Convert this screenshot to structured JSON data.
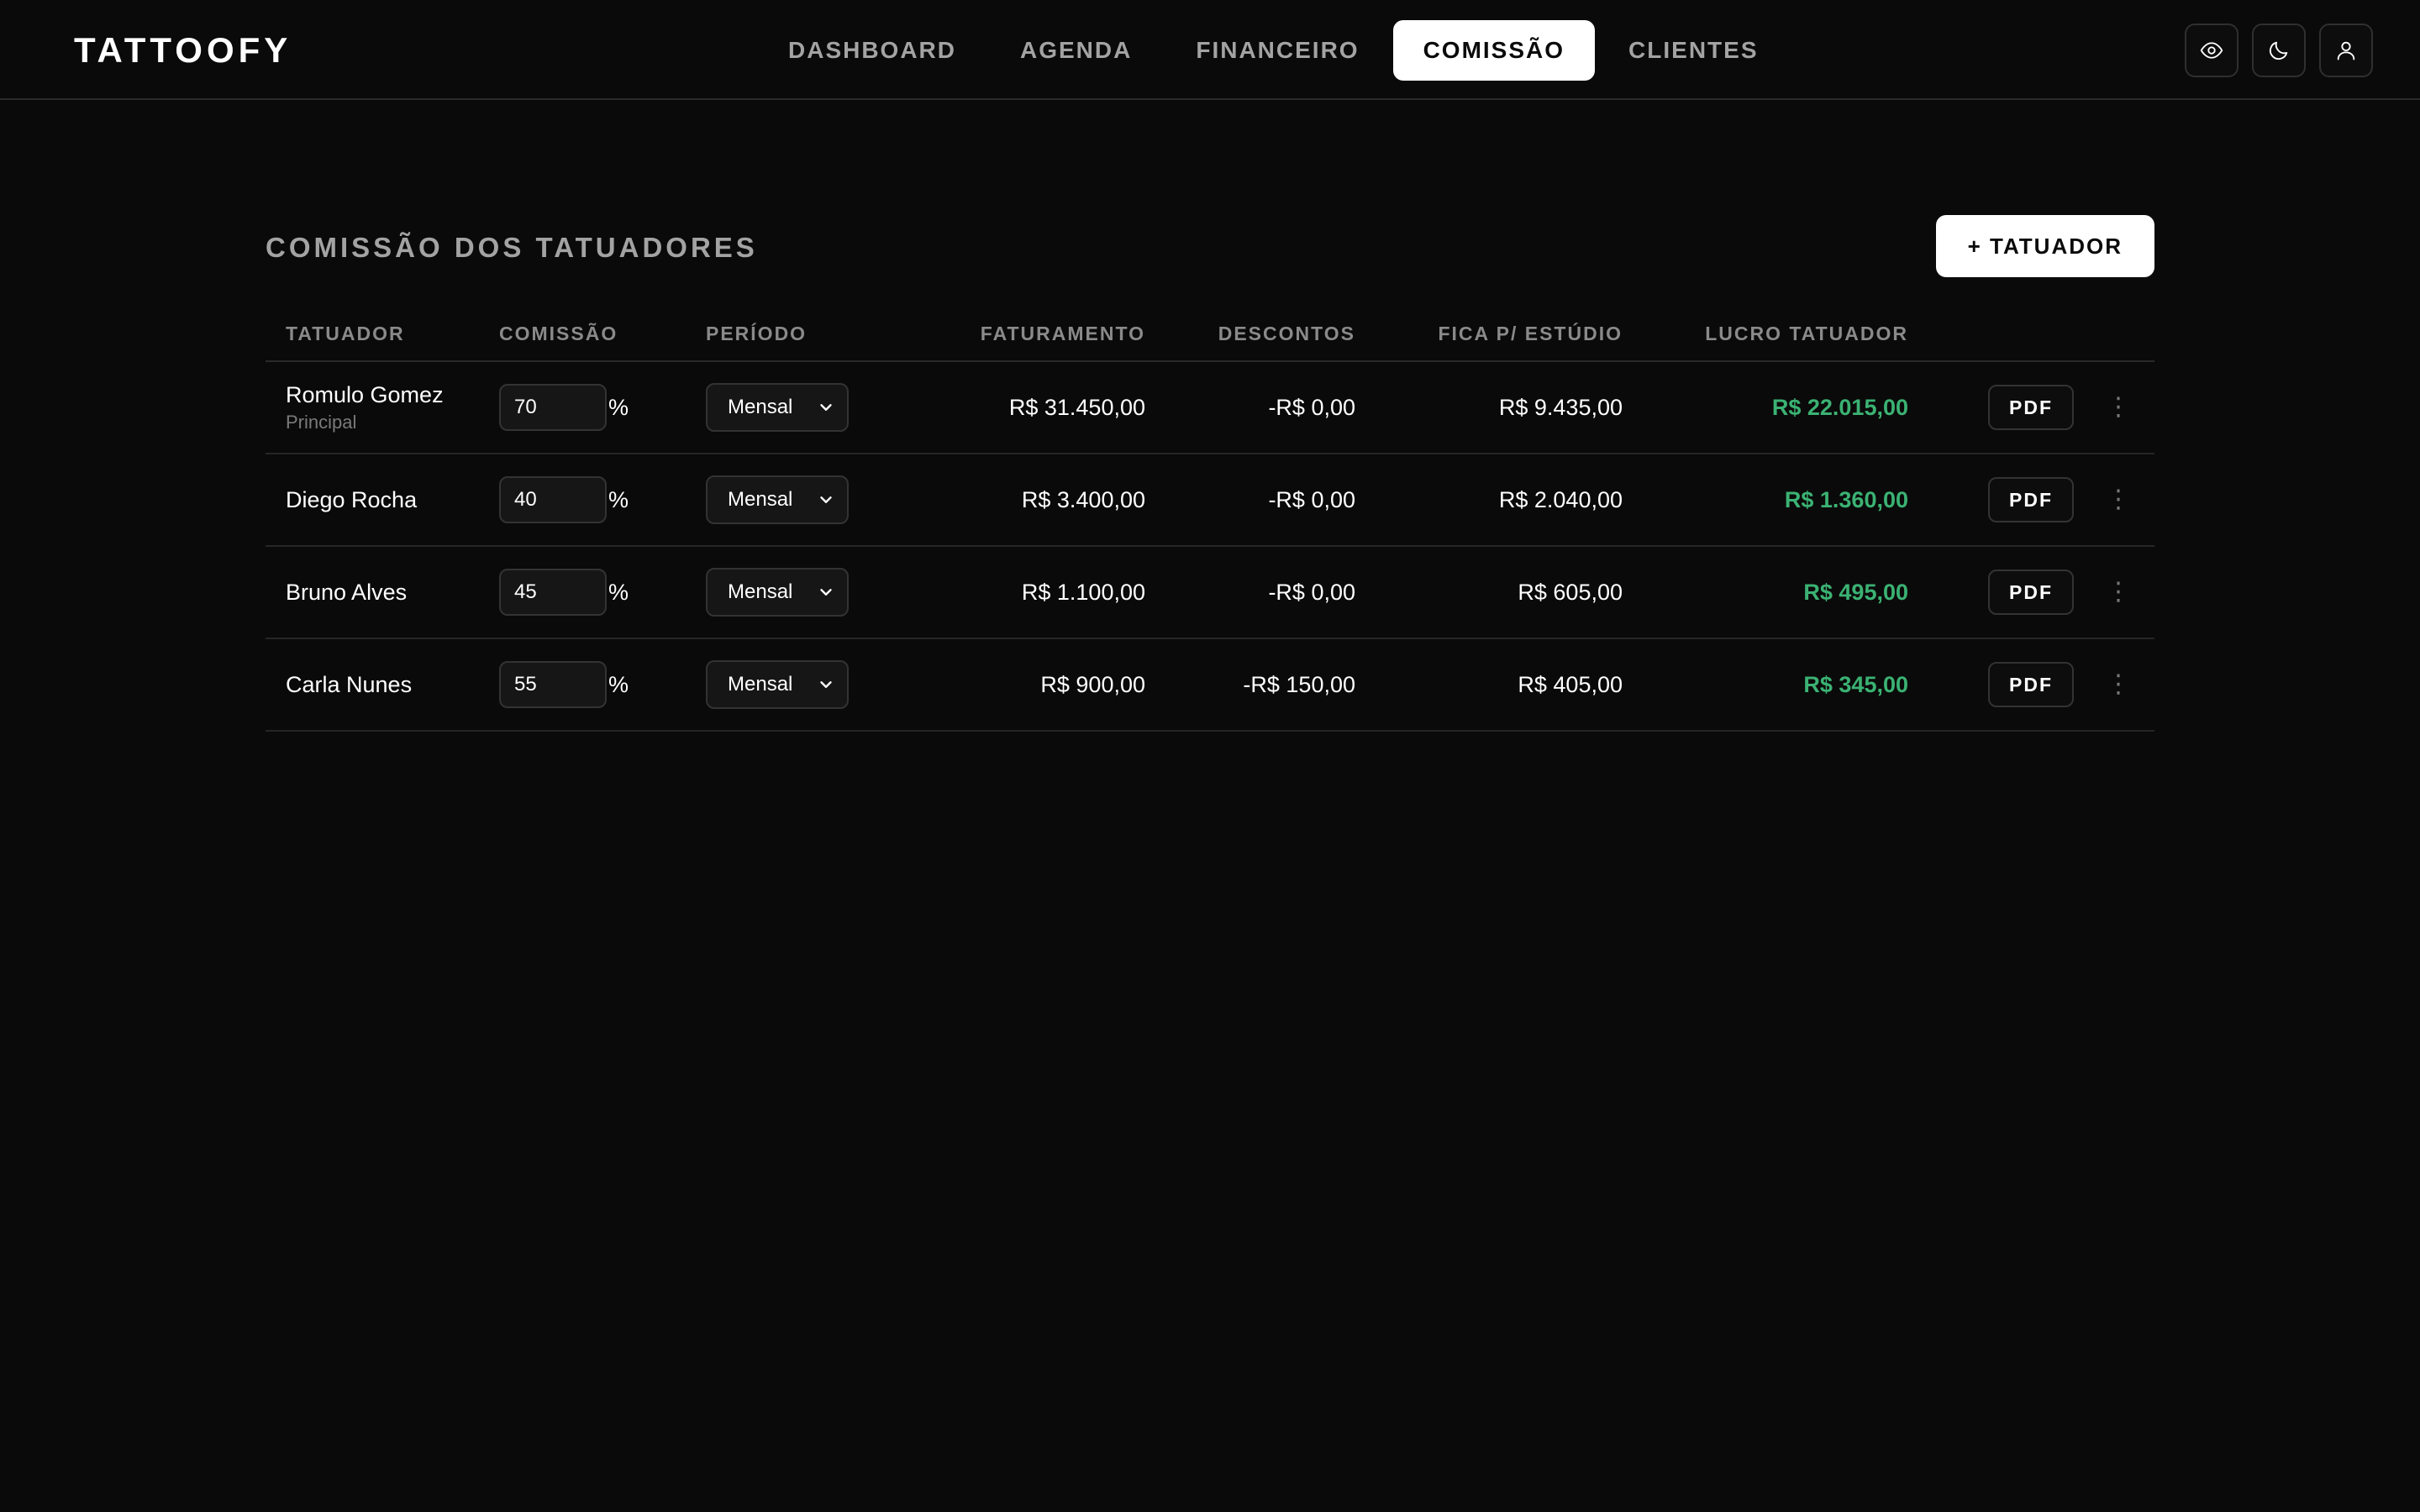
{
  "header": {
    "brand": "TATTOOFY",
    "nav": [
      {
        "label": "DASHBOARD",
        "active": false
      },
      {
        "label": "AGENDA",
        "active": false
      },
      {
        "label": "FINANCEIRO",
        "active": false
      },
      {
        "label": "COMISSÃO",
        "active": true
      },
      {
        "label": "CLIENTES",
        "active": false
      }
    ],
    "icons": [
      "eye-icon",
      "moon-icon",
      "user-icon"
    ]
  },
  "main": {
    "title": "COMISSÃO DOS TATUADORES",
    "add_button": "+ TATUADOR",
    "columns": [
      "TATUADOR",
      "COMISSÃO",
      "PERÍODO",
      "FATURAMENTO",
      "DESCONTOS",
      "FICA P/ ESTÚDIO",
      "LUCRO TATUADOR"
    ],
    "percent_symbol": "%",
    "pdf_label": "PDF",
    "rows": [
      {
        "name": "Romulo Gomez",
        "sub": "Principal",
        "commission": "70",
        "period": "Mensal",
        "faturamento": "R$ 31.450,00",
        "descontos": "-R$ 0,00",
        "fica": "R$ 9.435,00",
        "lucro": "R$ 22.015,00"
      },
      {
        "name": "Diego Rocha",
        "sub": "",
        "commission": "40",
        "period": "Mensal",
        "faturamento": "R$ 3.400,00",
        "descontos": "-R$ 0,00",
        "fica": "R$ 2.040,00",
        "lucro": "R$ 1.360,00"
      },
      {
        "name": "Bruno Alves",
        "sub": "",
        "commission": "45",
        "period": "Mensal",
        "faturamento": "R$ 1.100,00",
        "descontos": "-R$ 0,00",
        "fica": "R$ 605,00",
        "lucro": "R$ 495,00"
      },
      {
        "name": "Carla Nunes",
        "sub": "",
        "commission": "55",
        "period": "Mensal",
        "faturamento": "R$ 900,00",
        "descontos": "-R$ 150,00",
        "fica": "R$ 405,00",
        "lucro": "R$ 345,00"
      }
    ]
  },
  "colors": {
    "background": "#0a0a0a",
    "accent_green": "#3bb273",
    "muted": "#a3a3a3"
  }
}
